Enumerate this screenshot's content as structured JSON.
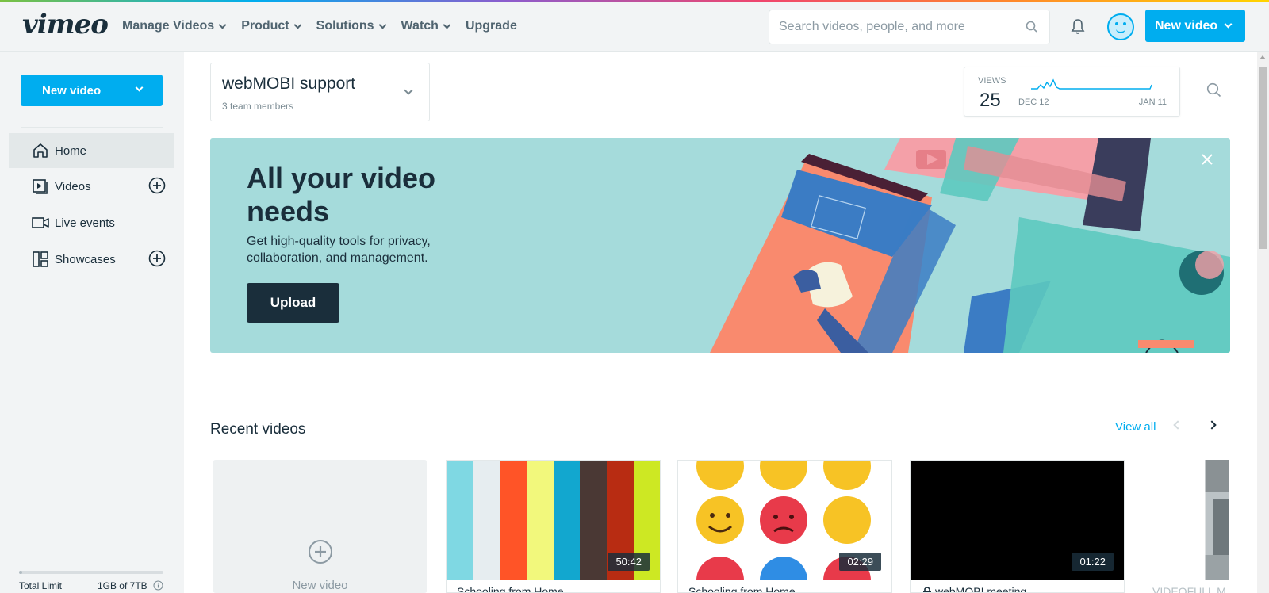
{
  "header": {
    "logo": "vimeo",
    "nav": [
      {
        "label": "Manage Videos",
        "dropdown": true
      },
      {
        "label": "Product",
        "dropdown": true
      },
      {
        "label": "Solutions",
        "dropdown": true
      },
      {
        "label": "Watch",
        "dropdown": true
      },
      {
        "label": "Upgrade",
        "dropdown": false
      }
    ],
    "search_placeholder": "Search videos, people, and more",
    "new_video_label": "New video"
  },
  "sidebar": {
    "new_video_label": "New video",
    "items": [
      {
        "label": "Home",
        "icon": "home-icon",
        "active": true
      },
      {
        "label": "Videos",
        "icon": "videos-icon",
        "add": true
      },
      {
        "label": "Live events",
        "icon": "camera-icon"
      },
      {
        "label": "Showcases",
        "icon": "showcases-icon",
        "add": true
      }
    ],
    "storage": {
      "label": "Total Limit",
      "value": "1GB of 7TB",
      "used_fraction": 0.01
    }
  },
  "team": {
    "name": "webMOBI support",
    "members": "3 team members"
  },
  "stats": {
    "label": "VIEWS",
    "count": "25",
    "start_date": "DEC 12",
    "end_date": "JAN 11"
  },
  "banner": {
    "title": "All your video needs",
    "subtitle": "Get high-quality tools for privacy, collaboration, and management.",
    "upload_label": "Upload"
  },
  "recent": {
    "title": "Recent videos",
    "view_all": "View all",
    "new_video_card": "New video",
    "videos": [
      {
        "title": "Schooling from Home",
        "duration": "50:42"
      },
      {
        "title": "Schooling from Home",
        "duration": "02:29"
      },
      {
        "title": "webMOBI meeting",
        "duration": "01:22",
        "private": true
      },
      {
        "title": "VIDEOFULL M",
        "duration": ""
      }
    ]
  },
  "colors": {
    "accent": "#00adef",
    "dark": "#1a2e3b",
    "banner_bg": "#a5dbdb"
  }
}
